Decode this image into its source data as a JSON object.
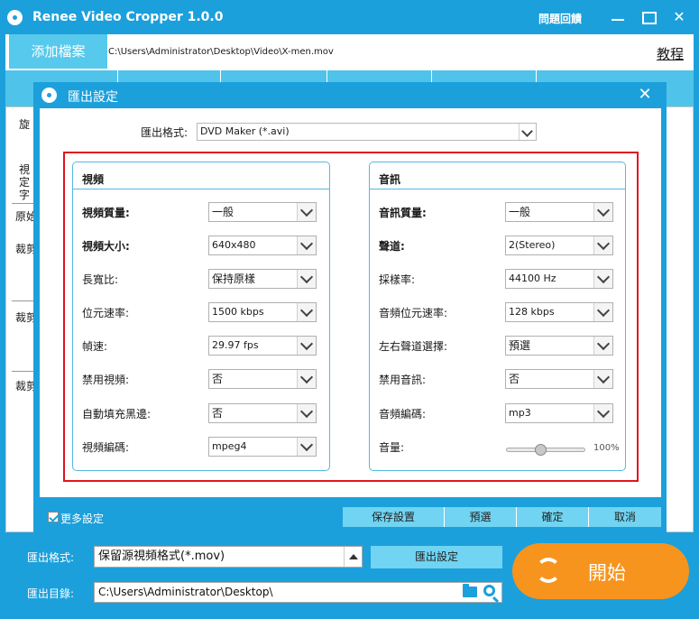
{
  "app": {
    "title": "Renee Video Cropper 1.0.0",
    "help": "問題回饋"
  },
  "file": {
    "add_button": "添加檔案",
    "path": "C:\\Users\\Administrator\\Desktop\\Video\\X-men.mov",
    "tutorial": "教程"
  },
  "background_labels": [
    "旋",
    "視",
    "定",
    "字",
    "原始",
    "裁剪",
    "裁剪",
    "裁剪"
  ],
  "dialog": {
    "title": "匯出設定",
    "format_label": "匯出格式:",
    "format_value": "DVD Maker (*.avi)",
    "video": {
      "title": "視頻",
      "rows": [
        {
          "label": "視頻質量:",
          "value": "一般",
          "bold": true
        },
        {
          "label": "視頻大小:",
          "value": "640x480",
          "bold": true
        },
        {
          "label": "長寬比:",
          "value": "保持原樣",
          "bold": false
        },
        {
          "label": "位元速率:",
          "value": "1500 kbps",
          "bold": false
        },
        {
          "label": "幀速:",
          "value": "29.97 fps",
          "bold": false
        },
        {
          "label": "禁用視頻:",
          "value": "否",
          "bold": false
        },
        {
          "label": "自動填充黑邊:",
          "value": "否",
          "bold": false
        },
        {
          "label": "視頻編碼:",
          "value": "mpeg4",
          "bold": false
        }
      ]
    },
    "audio": {
      "title": "音訊",
      "rows": [
        {
          "label": "音訊質量:",
          "value": "一般",
          "bold": true
        },
        {
          "label": "聲道:",
          "value": "2(Stereo)",
          "bold": true
        },
        {
          "label": "採樣率:",
          "value": "44100 Hz",
          "bold": false
        },
        {
          "label": "音頻位元速率:",
          "value": "128 kbps",
          "bold": false
        },
        {
          "label": "左右聲道選擇:",
          "value": "預選",
          "bold": false
        },
        {
          "label": "禁用音訊:",
          "value": "否",
          "bold": false
        },
        {
          "label": "音頻編碼:",
          "value": "mp3",
          "bold": false
        }
      ],
      "volume_label": "音量:",
      "volume_value": "100%",
      "volume_level": 0.42
    },
    "more_settings": "更多設定",
    "buttons": {
      "save": "保存設置",
      "default": "預選",
      "ok": "確定",
      "cancel": "取消"
    }
  },
  "bottom": {
    "format_label": "匯出格式:",
    "format_value": "保留源視頻格式(*.mov)",
    "settings_button": "匯出設定",
    "dir_label": "匯出目錄:",
    "dir_value": "C:\\Users\\Administrator\\Desktop\\",
    "start_button": "開始"
  },
  "colors": {
    "primary": "#1ca0dc",
    "accent": "#f7941d",
    "button": "#70d4f2",
    "highlight": "#e0141e"
  }
}
